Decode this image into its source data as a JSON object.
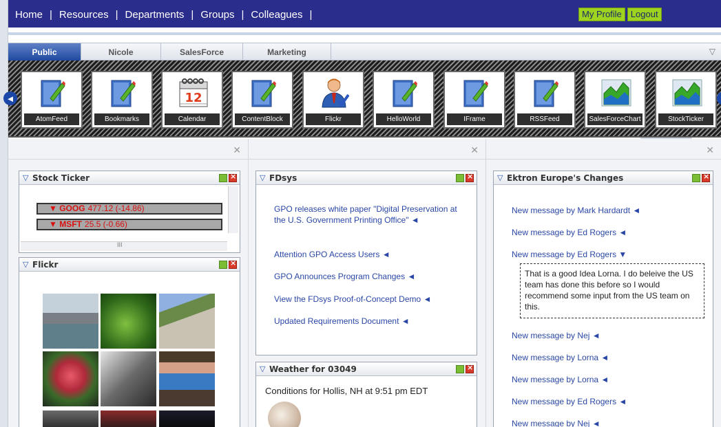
{
  "nav": {
    "links": [
      "Home",
      "Resources",
      "Departments",
      "Groups",
      "Colleagues"
    ],
    "my_profile": "My Profile",
    "logout": "Logout"
  },
  "tabs": [
    "Public",
    "Nicole",
    "SalesForce",
    "Marketing"
  ],
  "widgets": [
    "AtomFeed",
    "Bookmarks",
    "Calendar",
    "ContentBlock",
    "Flickr",
    "HelloWorld",
    "IFrame",
    "RSSFeed",
    "SalesForceChart",
    "StockTicker"
  ],
  "calendar_day": "12",
  "stock_ticker": {
    "title": "Stock Ticker",
    "rows": [
      {
        "symbol": "GOOG",
        "quote": "477.12 (-14.86)"
      },
      {
        "symbol": "MSFT",
        "quote": "25.5 (-0.66)"
      }
    ],
    "hscroll_grip": "III"
  },
  "flickr": {
    "title": "Flickr"
  },
  "fdsys": {
    "title": "FDsys",
    "items": [
      "GPO releases white paper \"Digital Preservation at the U.S. Government Printing Office\" ◄",
      "Attention GPO Access Users ◄",
      "GPO Announces Program Changes ◄",
      "View the FDsys Proof-of-Concept Demo ◄",
      "Updated Requirements Document ◄"
    ]
  },
  "weather": {
    "title": "Weather for 03049",
    "conditions": "Conditions for Hollis, NH at 9:51 pm EDT"
  },
  "ektron": {
    "title": "Ektron Europe's Changes",
    "messages": [
      "New message by Mark Hardardt ◄",
      "New message by Ed Rogers ◄",
      "New message by Ed Rogers ▼",
      "New message by Nej ◄",
      "New message by Lorna ◄",
      "New message by Lorna ◄",
      "New message by Ed Rogers ◄",
      "New message by Nej ◄"
    ],
    "comment": "That is a good Idea Lorna. I do beleive the US team has done this before so I would recommend some input from the US team on this."
  },
  "colors": {
    "nav_bg": "#2b2d8c",
    "active_tab": "#1f4aa0",
    "link": "#2a47a6",
    "profile_btn": "#9ed31f"
  }
}
